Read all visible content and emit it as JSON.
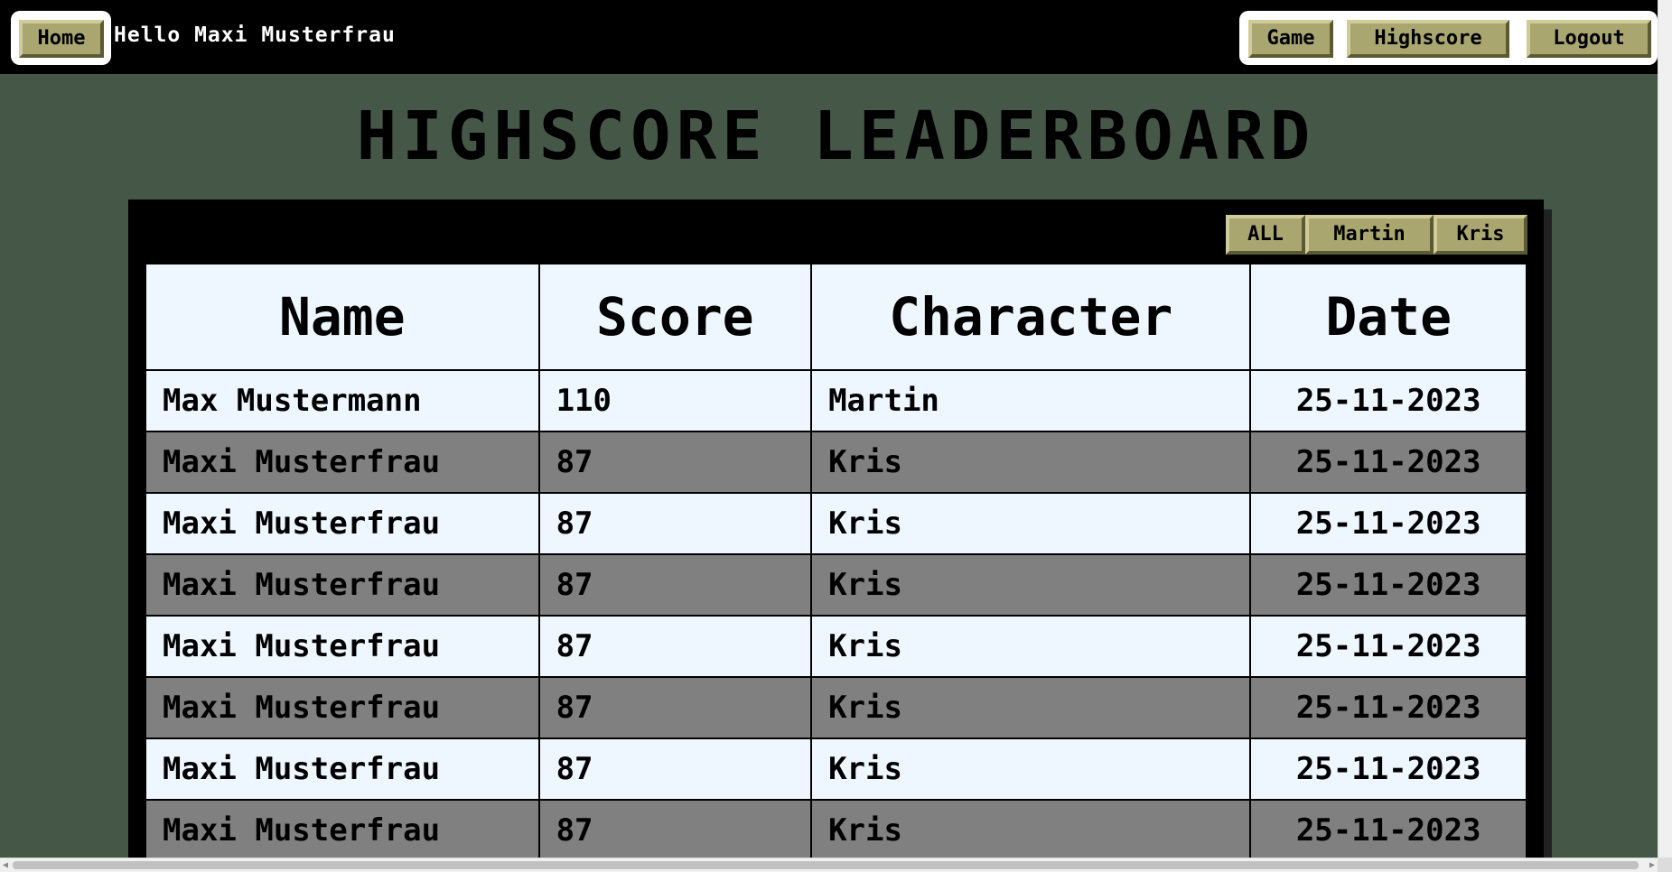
{
  "header": {
    "home_label": "Home",
    "greeting": "Hello Maxi Musterfrau",
    "nav": {
      "game_label": "Game",
      "highscore_label": "Highscore",
      "logout_label": "Logout"
    }
  },
  "title": "HIGHSCORE LEADERBOARD",
  "filters": {
    "all_label": "ALL",
    "martin_label": "Martin",
    "kris_label": "Kris"
  },
  "table": {
    "headers": [
      "Name",
      "Score",
      "Character",
      "Date"
    ],
    "rows": [
      {
        "name": "Max Mustermann",
        "score": "110",
        "character": "Martin",
        "date": "25-11-2023"
      },
      {
        "name": "Maxi Musterfrau",
        "score": "87",
        "character": "Kris",
        "date": "25-11-2023"
      },
      {
        "name": "Maxi Musterfrau",
        "score": "87",
        "character": "Kris",
        "date": "25-11-2023"
      },
      {
        "name": "Maxi Musterfrau",
        "score": "87",
        "character": "Kris",
        "date": "25-11-2023"
      },
      {
        "name": "Maxi Musterfrau",
        "score": "87",
        "character": "Kris",
        "date": "25-11-2023"
      },
      {
        "name": "Maxi Musterfrau",
        "score": "87",
        "character": "Kris",
        "date": "25-11-2023"
      },
      {
        "name": "Maxi Musterfrau",
        "score": "87",
        "character": "Kris",
        "date": "25-11-2023"
      },
      {
        "name": "Maxi Musterfrau",
        "score": "87",
        "character": "Kris",
        "date": "25-11-2023"
      }
    ]
  },
  "colors": {
    "background": "#455848",
    "button": "#a9a670",
    "row_light": "#eef6ff",
    "row_dark": "#808080"
  }
}
